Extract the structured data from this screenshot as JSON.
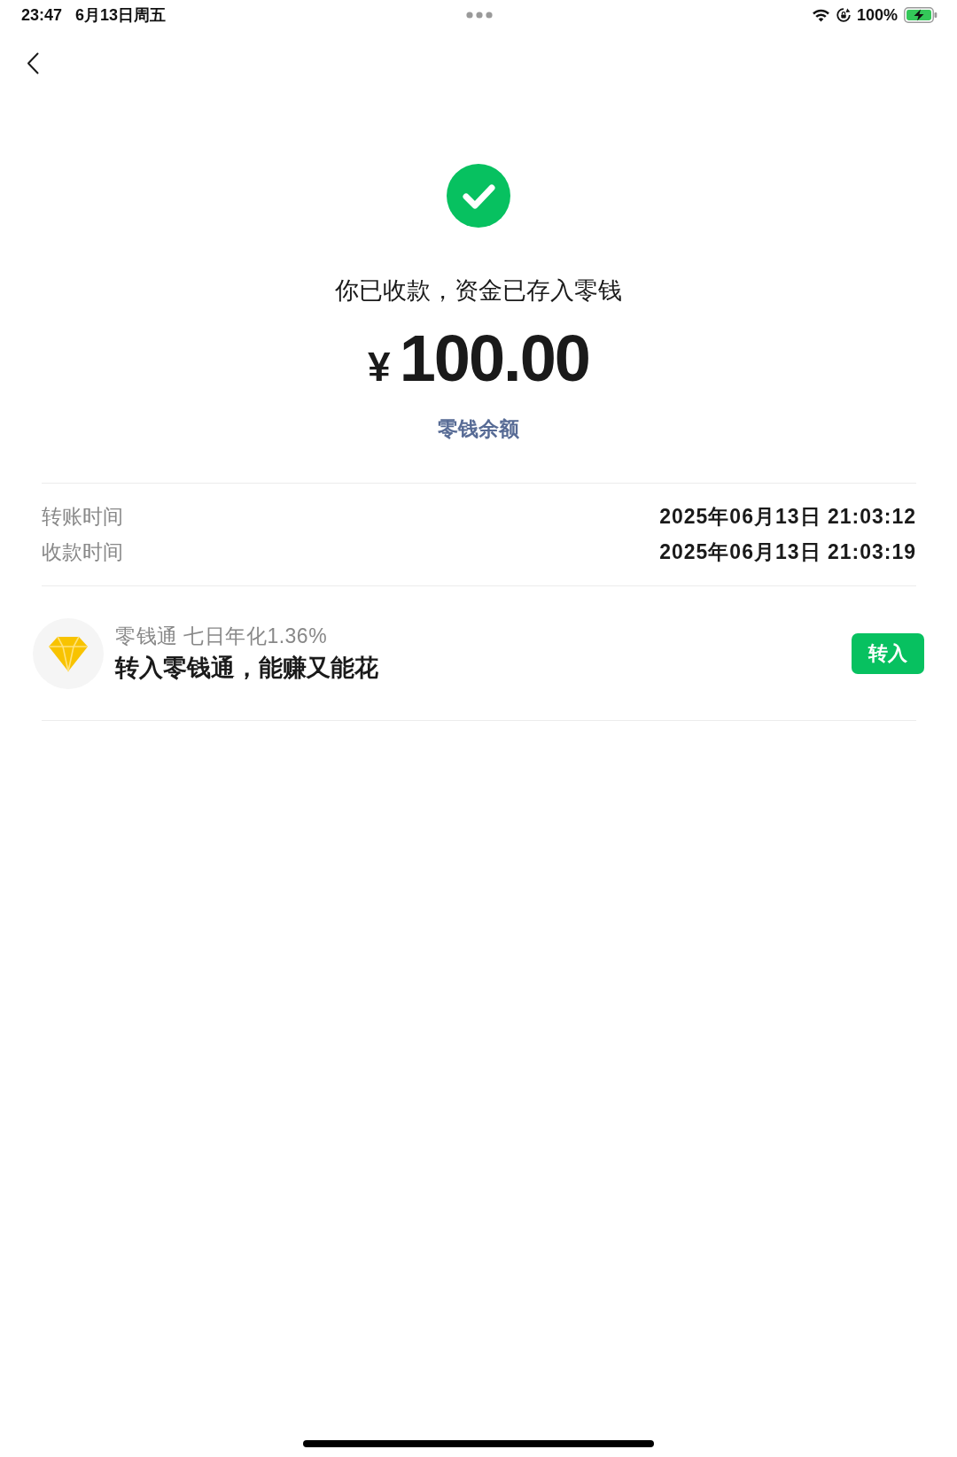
{
  "status_bar": {
    "time": "23:47",
    "date": "6月13日周五",
    "battery": "100%"
  },
  "result": {
    "title": "你已收款，资金已存入零钱",
    "currency": "¥",
    "amount": "100.00",
    "balance_link": "零钱余额"
  },
  "details": [
    {
      "label": "转账时间",
      "value": "2025年06月13日 21:03:12"
    },
    {
      "label": "收款时间",
      "value": "2025年06月13日 21:03:19"
    }
  ],
  "promo": {
    "title": "零钱通 七日年化1.36%",
    "subtitle": "转入零钱通，能赚又能花",
    "button": "转入"
  }
}
